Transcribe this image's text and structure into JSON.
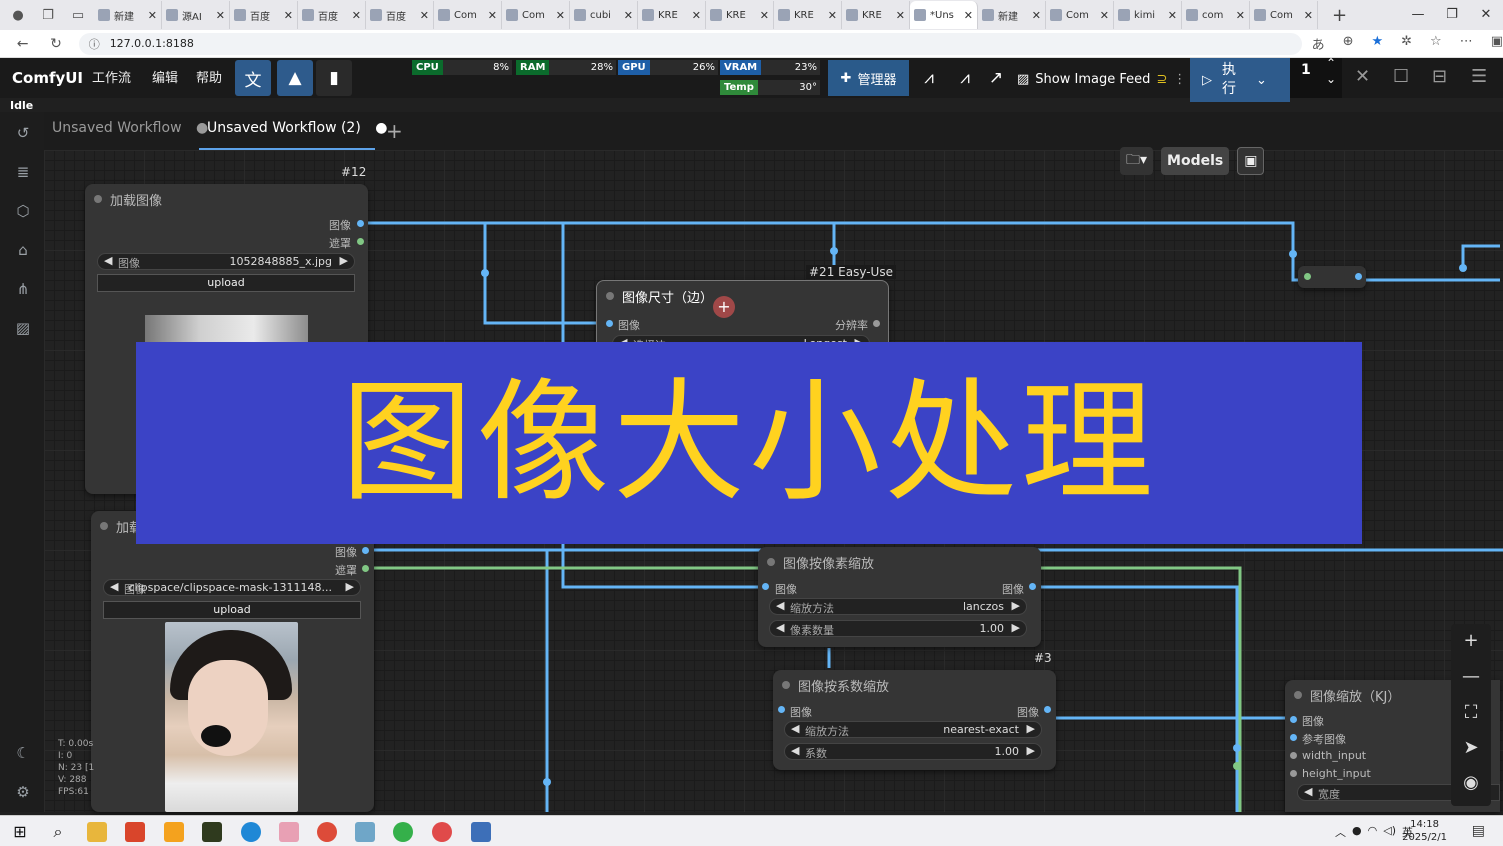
{
  "browser": {
    "tabs": [
      {
        "label": "新建",
        "active": false
      },
      {
        "label": "源AI",
        "active": false
      },
      {
        "label": "百度",
        "active": false
      },
      {
        "label": "百度",
        "active": false
      },
      {
        "label": "百度",
        "active": false
      },
      {
        "label": "Com",
        "active": false
      },
      {
        "label": "Com",
        "active": false
      },
      {
        "label": "cubi",
        "active": false
      },
      {
        "label": "KRE",
        "active": false
      },
      {
        "label": "KRE",
        "active": false
      },
      {
        "label": "KRE",
        "active": false
      },
      {
        "label": "KRE",
        "active": false
      },
      {
        "label": "*Uns",
        "active": true
      },
      {
        "label": "新建",
        "active": false
      },
      {
        "label": "Com",
        "active": false
      },
      {
        "label": "kimi",
        "active": false
      },
      {
        "label": "com",
        "active": false
      },
      {
        "label": "Com",
        "active": false
      }
    ],
    "url": "127.0.0.1:8188"
  },
  "comfy": {
    "logo": "ComfyUI",
    "menu": [
      "工作流",
      "编辑",
      "帮助"
    ],
    "status": "Idle",
    "monitor": {
      "cpu": {
        "label": "CPU",
        "value": "8%",
        "fraction": 0.08
      },
      "ram": {
        "label": "RAM",
        "value": "28%",
        "fraction": 0.28
      },
      "gpu": {
        "label": "GPU",
        "value": "26%",
        "fraction": 0.26
      },
      "vram": {
        "label": "VRAM",
        "value": "23%",
        "fraction": 0.23
      },
      "temp": {
        "label": "Temp",
        "value": "30°",
        "fraction": 0.3
      }
    },
    "manager_label": "管理器",
    "image_feed_label": "Show Image Feed",
    "run_label": "执行",
    "batch_count": "1"
  },
  "workflow_tabs": [
    {
      "label": "Unsaved Workflow",
      "active": false
    },
    {
      "label": "Unsaved Workflow (2)",
      "active": true
    }
  ],
  "canvas_tools": {
    "models_label": "Models"
  },
  "nodes": {
    "load1": {
      "id": "#12",
      "title": "加载图像",
      "outputs": [
        "图像",
        "遮罩"
      ],
      "widget_label": "图像",
      "widget_value": "1052848885_x.jpg",
      "upload": "upload"
    },
    "load2": {
      "title": "加载",
      "outputs": [
        "图像",
        "遮罩"
      ],
      "widget_label": "图像",
      "widget_value": "clipspace/clipspace-mask-1311148...",
      "upload": "upload"
    },
    "size": {
      "id": "#21 Easy-Use",
      "title": "图像尺寸（边）",
      "input": "图像",
      "output": "分辨率",
      "widget_label": "选择边",
      "widget_value": "Longest"
    },
    "pixel_scale": {
      "title": "图像按像素缩放",
      "input": "图像",
      "output": "图像",
      "w1_label": "缩放方法",
      "w1_value": "lanczos",
      "w2_label": "像素数量",
      "w2_value": "1.00"
    },
    "factor_scale": {
      "id": "#3",
      "title": "图像按系数缩放",
      "input": "图像",
      "output": "图像",
      "w1_label": "缩放方法",
      "w1_value": "nearest-exact",
      "w2_label": "系数",
      "w2_value": "1.00"
    },
    "kj_resize": {
      "title": "图像缩放（KJ）",
      "inputs": [
        "图像",
        "参考图像",
        "width_input",
        "height_input"
      ],
      "widget_label": "宽度"
    }
  },
  "stats": [
    "T: 0.00s",
    "I: 0",
    "N: 23 [1",
    "V: 288",
    "FPS:61"
  ],
  "banner_text": "图像大小处理",
  "taskbar": {
    "ime": "英",
    "time": "14:18",
    "date": "2025/2/1"
  },
  "colors": {
    "accent": "#3b43c6",
    "banner_text": "#ffd21f",
    "wire_image": "#64b5f6",
    "wire_mask": "#81c784",
    "run_button": "#2e5b8c"
  }
}
